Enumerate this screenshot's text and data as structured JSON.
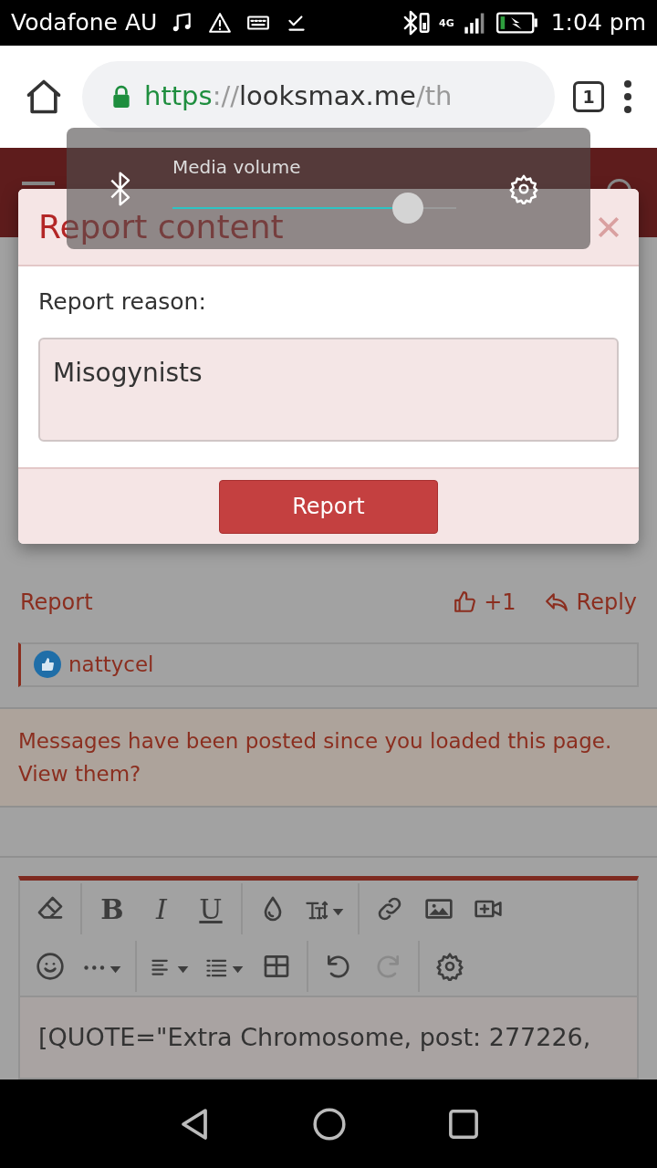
{
  "status_bar": {
    "carrier": "Vodafone AU",
    "network": "4G",
    "time": "1:04 pm"
  },
  "browser": {
    "url": {
      "scheme": "https",
      "separator": "://",
      "host": "looksmax.me",
      "path": "/th"
    },
    "tab_count": "1"
  },
  "post": {
    "actions": {
      "report": "Report",
      "like": "+1",
      "reply": "Reply"
    },
    "reactions": {
      "user": "nattycel"
    }
  },
  "notice": {
    "text": "Messages have been posted since you loaded this page. View them?"
  },
  "editor": {
    "toolbar": [
      [
        [
          {
            "kind": "icon",
            "dropdown": false,
            "disabled": false
          }
        ],
        [
          {
            "kind": "glyph",
            "label": "B",
            "dropdown": false,
            "disabled": false
          },
          {
            "kind": "glyph",
            "label": "I",
            "dropdown": false,
            "disabled": false
          },
          {
            "kind": "glyph",
            "label": "U",
            "dropdown": false,
            "disabled": false
          }
        ],
        [
          {
            "kind": "icon",
            "dropdown": false,
            "disabled": false
          },
          {
            "kind": "icon",
            "dropdown": true,
            "disabled": false
          }
        ],
        [
          {
            "kind": "icon",
            "dropdown": false,
            "disabled": false
          },
          {
            "kind": "icon",
            "dropdown": false,
            "disabled": false
          },
          {
            "kind": "icon",
            "dropdown": false,
            "disabled": false
          }
        ]
      ],
      [
        [
          {
            "kind": "icon",
            "dropdown": false,
            "disabled": false
          },
          {
            "kind": "icon",
            "dropdown": true,
            "disabled": false
          }
        ],
        [
          {
            "kind": "icon",
            "dropdown": true,
            "disabled": false
          },
          {
            "kind": "icon",
            "dropdown": true,
            "disabled": false
          },
          {
            "kind": "icon",
            "dropdown": false,
            "disabled": false
          }
        ],
        [
          {
            "kind": "icon",
            "dropdown": false,
            "disabled": false
          },
          {
            "kind": "icon",
            "dropdown": false,
            "disabled": true
          }
        ],
        [
          {
            "kind": "icon",
            "dropdown": false,
            "disabled": false
          }
        ]
      ]
    ],
    "content": "[QUOTE=\"Extra Chromosome, post: 277226,"
  },
  "modal": {
    "title": "Report content",
    "label": "Report reason:",
    "value": "Misogynists",
    "button": "Report"
  },
  "volume_panel": {
    "label": "Media volume",
    "level": 0.83
  }
}
